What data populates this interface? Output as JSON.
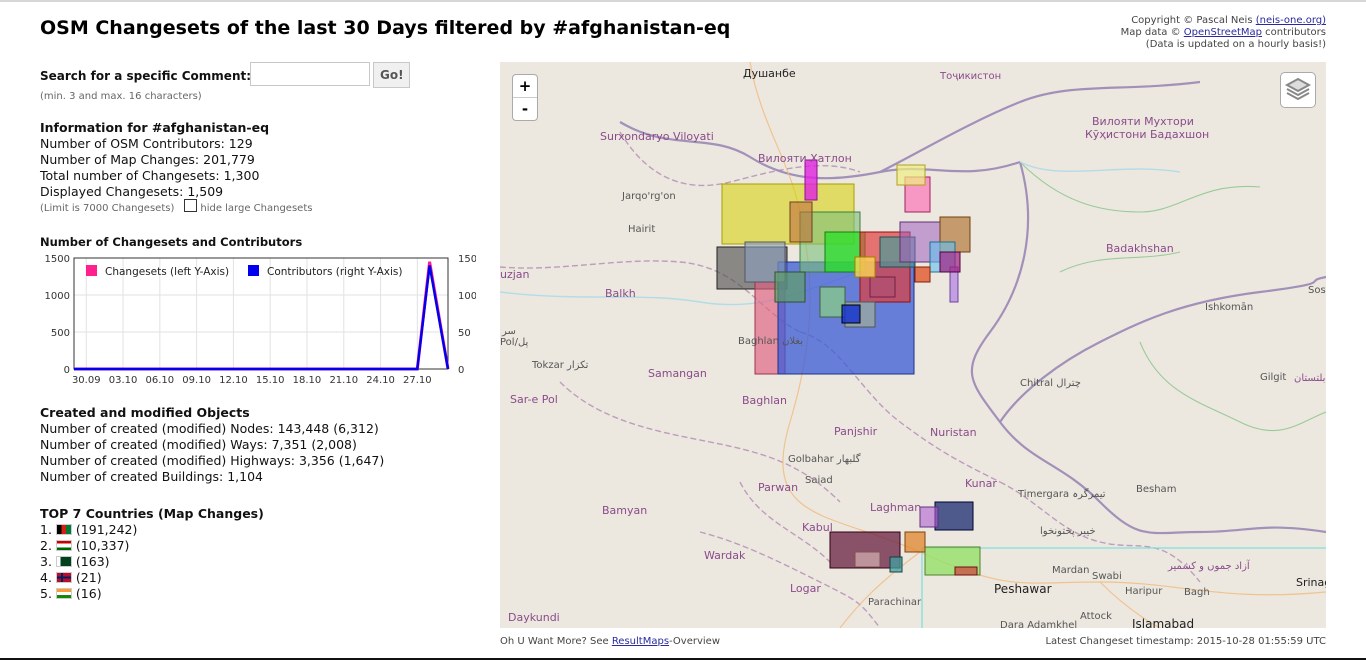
{
  "title": "OSM Changesets of the last 30 Days filtered by #afghanistan-eq",
  "copyright": {
    "line1_prefix": "Copyright © Pascal Neis ",
    "line1_link": "(neis-one.org)",
    "line2_prefix": "Map data © ",
    "line2_link": "OpenStreetMap",
    "line2_suffix": " contributors",
    "line3": "(Data is updated on a hourly basis!)"
  },
  "search": {
    "label": "Search for a specific Comment:",
    "value": "",
    "placeholder": "",
    "button": "Go!",
    "hint": "(min. 3 and max. 16 characters)"
  },
  "info": {
    "heading": "Information for #afghanistan-eq",
    "contributors": "Number of OSM Contributors: 129",
    "map_changes": "Number of Map Changes: 201,779",
    "total_changesets": "Total number of Changesets: 1,300",
    "displayed": "Displayed Changesets: 1,509",
    "limit": "(Limit is 7000 Changesets)",
    "hide_large": "hide large Changesets"
  },
  "chart_title": "Number of Changesets and Contributors",
  "chart_data": {
    "type": "line",
    "x": [
      "30.09",
      "03.10",
      "06.10",
      "09.10",
      "12.10",
      "15.10",
      "18.10",
      "21.10",
      "24.10",
      "27.10"
    ],
    "series": [
      {
        "name": "Changesets (left Y-Axis)",
        "color": "#ff1f8f",
        "points": [
          [
            0,
            0
          ],
          [
            25,
            0
          ],
          [
            28,
            0
          ],
          [
            29,
            1450
          ],
          [
            30.5,
            0
          ]
        ]
      },
      {
        "name": "Contributors (right Y-Axis)",
        "color": "#0000ee",
        "points": [
          [
            0,
            0
          ],
          [
            25,
            0
          ],
          [
            28,
            0
          ],
          [
            29,
            140
          ],
          [
            30.5,
            0
          ]
        ]
      }
    ],
    "xlim": [
      0,
      30.5
    ],
    "y_left_ticks": [
      "1500",
      "1000",
      "500",
      "0"
    ],
    "y_right_ticks": [
      "150",
      "100",
      "50",
      "0"
    ],
    "ylim_left": [
      0,
      1500
    ],
    "ylim_right": [
      0,
      150
    ],
    "grid": true,
    "legend": "top-left"
  },
  "objects": {
    "heading": "Created and modified Objects",
    "nodes": "Number of created (modified) Nodes: 143,448 (6,312)",
    "ways": "Number of created (modified) Ways: 7,351 (2,008)",
    "highways": "Number of created (modified) Highways: 3,356 (1,647)",
    "buildings": "Number of created Buildings: 1,104"
  },
  "countries": {
    "heading": "TOP 7 Countries (Map Changes)",
    "items": [
      {
        "rank": "1.",
        "value": "(191,242)",
        "flag": "afghanistan"
      },
      {
        "rank": "2.",
        "value": "(10,337)",
        "flag": "tajikistan"
      },
      {
        "rank": "3.",
        "value": "(163)",
        "flag": "pakistan"
      },
      {
        "rank": "4.",
        "value": "(21)",
        "flag": "norway"
      },
      {
        "rank": "5.",
        "value": "(16)",
        "flag": "india"
      }
    ]
  },
  "map": {
    "zoom_in": "+",
    "zoom_out": "-",
    "labels": [
      "Душанбе",
      "Тоҷикистон",
      "Вилояти Мухтори",
      "Кӯҳистони Бадахшон",
      "Surxondaryo Viloyati",
      "Вилояти Хатлон",
      "Jarqo'rg'on",
      "Hairit",
      "Balkh",
      "Badakhshan",
      "Ishkomān",
      "Baghlan بغلان",
      "Tokzar تكزار",
      "Samangan",
      "Sar-e Pol",
      "Baghlan",
      "Chitral چترال",
      "Gilgit",
      "Panjshir",
      "Nuristan",
      "Golbahar گلبهار",
      "Saiad",
      "Parwan",
      "Kunar",
      "Laghman",
      "Timergara تیمرگرہ",
      "Besham",
      "Bamyan",
      "Kabul",
      "خیبر پختونخوا",
      "Wardak",
      "Logar",
      "Parachinar",
      "Peshawar",
      "Mardan",
      "Swabi",
      "Haripur",
      "Bagh",
      "Islamabad",
      "Attock",
      "Dara Adamkhel",
      "Daykundi",
      "آزاد جموں و کشمیر",
      "Srinag",
      "Sost",
      "uzjan",
      "Pol/پل",
      "سر",
      "بلتستان"
    ]
  },
  "footer": {
    "prefix": "Oh U Want More? See ",
    "link": "ResultMaps",
    "suffix": "-Overview",
    "timestamp": "Latest Changeset timestamp: 2015-10-28 01:55:59 UTC"
  }
}
